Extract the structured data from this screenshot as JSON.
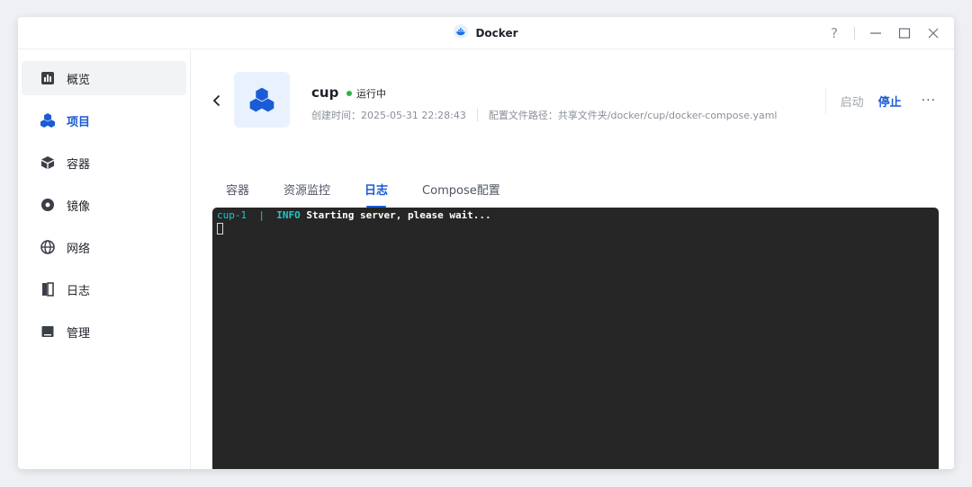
{
  "window": {
    "title": "Docker",
    "help_label": "?"
  },
  "sidebar": {
    "items": [
      {
        "label": "概览",
        "icon": "overview-icon"
      },
      {
        "label": "项目",
        "icon": "project-icon"
      },
      {
        "label": "容器",
        "icon": "container-icon"
      },
      {
        "label": "镜像",
        "icon": "image-icon"
      },
      {
        "label": "网络",
        "icon": "network-icon"
      },
      {
        "label": "日志",
        "icon": "log-icon"
      },
      {
        "label": "管理",
        "icon": "manage-icon"
      }
    ],
    "active_label": "项目"
  },
  "project": {
    "name": "cup",
    "status": "运行中",
    "status_color": "#2fb349",
    "created": "创建时间：2025-05-31 22:28:43",
    "config_path": "配置文件路径：共享文件夹/docker/cup/docker-compose.yaml"
  },
  "actions": {
    "start_label": "启动",
    "stop_label": "停止",
    "more_label": "···"
  },
  "tabs": [
    {
      "label": "容器"
    },
    {
      "label": "资源监控"
    },
    {
      "label": "日志"
    },
    {
      "label": "Compose配置"
    }
  ],
  "active_tab": "日志",
  "log": {
    "lines": [
      {
        "container": "cup-1",
        "separator": "|",
        "level": "INFO",
        "message": "Starting server, please wait..."
      }
    ]
  },
  "colors": {
    "accent": "#1a5bd6",
    "terminal_bg": "#262626",
    "log_prefix": "#1ec7c7"
  }
}
